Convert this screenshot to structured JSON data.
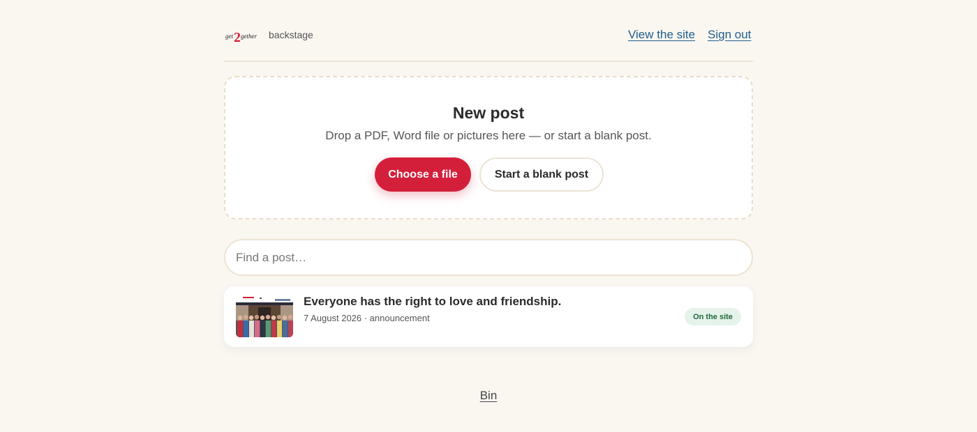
{
  "header": {
    "logo_text": "get2gether",
    "brand_sub": "backstage",
    "nav": {
      "view_site": "View the site",
      "sign_out": "Sign out"
    }
  },
  "new_post": {
    "title": "New post",
    "description": "Drop a PDF, Word file or pictures here — or start a blank post.",
    "choose_file_label": "Choose a file",
    "blank_post_label": "Start a blank post"
  },
  "search": {
    "placeholder": "Find a post…",
    "value": ""
  },
  "posts": [
    {
      "title": "Everyone has the right to love and friendship.",
      "meta": "7 August 2026 · announcement",
      "status": "On the site"
    }
  ],
  "footer": {
    "bin_label": "Bin"
  },
  "colors": {
    "background": "#faf7f1",
    "accent": "#d41f3a",
    "link": "#1f5d8a",
    "status_bg": "#e5f3ea",
    "status_text": "#21683d"
  }
}
